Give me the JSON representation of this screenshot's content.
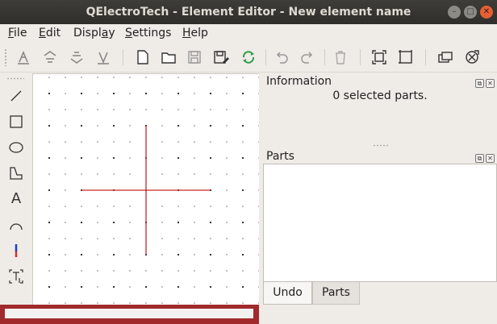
{
  "window": {
    "title": "QElectroTech - Element Editor - New element name",
    "minimize_glyph": "–",
    "maximize_glyph": "□",
    "close_glyph": "✕"
  },
  "menu": [
    {
      "id": "file",
      "mnemonic": "F",
      "rest": "ile"
    },
    {
      "id": "edit",
      "mnemonic": "E",
      "rest": "dit"
    },
    {
      "id": "display",
      "prefix": "Displ",
      "mnemonic": "a",
      "rest": "y"
    },
    {
      "id": "settings",
      "mnemonic": "S",
      "rest": "ettings"
    },
    {
      "id": "help",
      "mnemonic": "H",
      "rest": "elp"
    }
  ],
  "toolbar_icons": [
    "bring-forward-icon",
    "raise-icon",
    "lower-icon",
    "send-backward-icon",
    "new-icon",
    "open-icon",
    "save-icon",
    "save-as-icon",
    "reload-icon",
    "undo-icon",
    "redo-icon",
    "delete-icon",
    "zoom-fit-icon",
    "zoom-reset-icon",
    "edit-author-icon",
    "check-element-icon"
  ],
  "left_tools": [
    "line-icon",
    "rectangle-icon",
    "ellipse-icon",
    "polygon-icon",
    "text-icon",
    "arc-icon",
    "terminal-icon",
    "dynamic-text-icon"
  ],
  "text_tool_glyph": "A",
  "information": {
    "title": "Information",
    "text": "0 selected parts."
  },
  "parts": {
    "title": "Parts"
  },
  "tabs": {
    "undo": "Undo",
    "parts": "Parts"
  },
  "colors": {
    "accent_red": "#a12a2c",
    "cross_red": "#c62828",
    "terminal_blue": "#1f3fbf"
  }
}
